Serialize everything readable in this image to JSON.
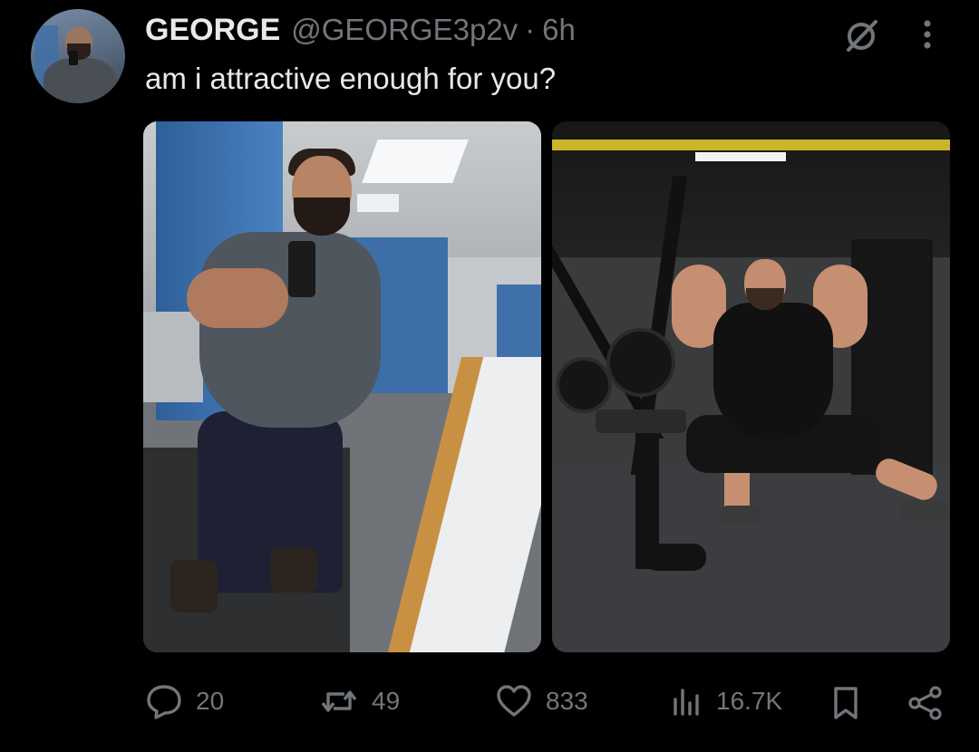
{
  "tweet": {
    "display_name": "GEORGE",
    "handle": "@GEORGE3p2v",
    "separator": "·",
    "time": "6h",
    "text": "am i attractive enough for you?"
  },
  "media": [
    {
      "label": "locker-room-selfie"
    },
    {
      "label": "gym-flex-photo"
    }
  ],
  "stats": {
    "replies": "20",
    "reposts": "49",
    "likes": "833",
    "views": "16.7K"
  },
  "icons": {
    "reply": "speech-bubble-icon",
    "repost": "repost-arrows-icon",
    "like": "heart-icon",
    "views": "bar-chart-icon",
    "bookmark": "bookmark-icon",
    "share": "share-icon",
    "grok": "grok-slash-icon",
    "more": "vertical-ellipsis-icon"
  },
  "colors": {
    "background": "#000000",
    "primary_text": "#e7e9ea",
    "secondary_text": "#71767b"
  }
}
